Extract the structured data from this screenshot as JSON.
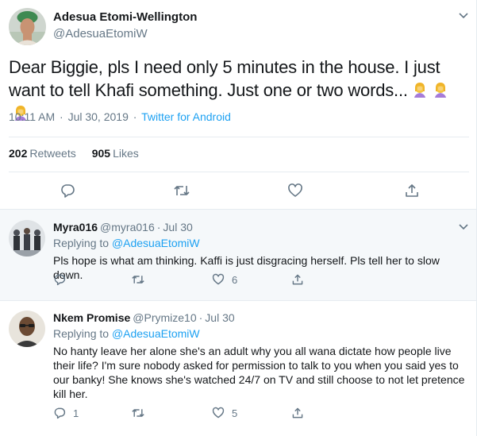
{
  "main_tweet": {
    "author_name": "Adesua Etomi-Wellington",
    "author_handle": "@AdesuaEtomiW",
    "text": "Dear Biggie, pls I need only 5 minutes in the house. I just want to tell Khafi something. Just one or two words...",
    "emoji": "face-palm-emoji",
    "emoji_count": 3,
    "time": "10:11 AM",
    "date": "Jul 30, 2019",
    "separator": "·",
    "client": "Twitter for Android",
    "retweets_count": "202",
    "retweets_label": "Retweets",
    "likes_count": "905",
    "likes_label": "Likes",
    "icons": [
      "reply-icon",
      "retweet-icon",
      "like-icon",
      "share-icon"
    ]
  },
  "replies": [
    {
      "name": "Myra016",
      "handle": "@myra016",
      "date": "Jul 30",
      "separator": "·",
      "replying_prefix": "Replying to",
      "replying_to": "@AdesuaEtomiW",
      "text": "Pls hope is what am thinking. Kaffi is just disgracing herself. Pls tell her to slow down.",
      "reply_count": "",
      "retweet_count": "",
      "like_count": "6"
    },
    {
      "name": "Nkem Promise",
      "handle": "@Prymize10",
      "date": "Jul 30",
      "separator": "·",
      "replying_prefix": "Replying to",
      "replying_to": "@AdesuaEtomiW",
      "text": "No hanty leave her alone she's an adult why you all wana dictate how people live their life? I'm sure nobody asked for permission to talk to you when you said yes to our banky! She knows she's watched 24/7 on TV and still choose to not let pretence kill her.",
      "reply_count": "1",
      "retweet_count": "",
      "like_count": "5"
    }
  ],
  "colors": {
    "accent": "#1da1f2",
    "muted": "#657786",
    "text": "#14171a",
    "divider": "#e6ecf0",
    "highlight_bg": "#f5f8fa"
  }
}
